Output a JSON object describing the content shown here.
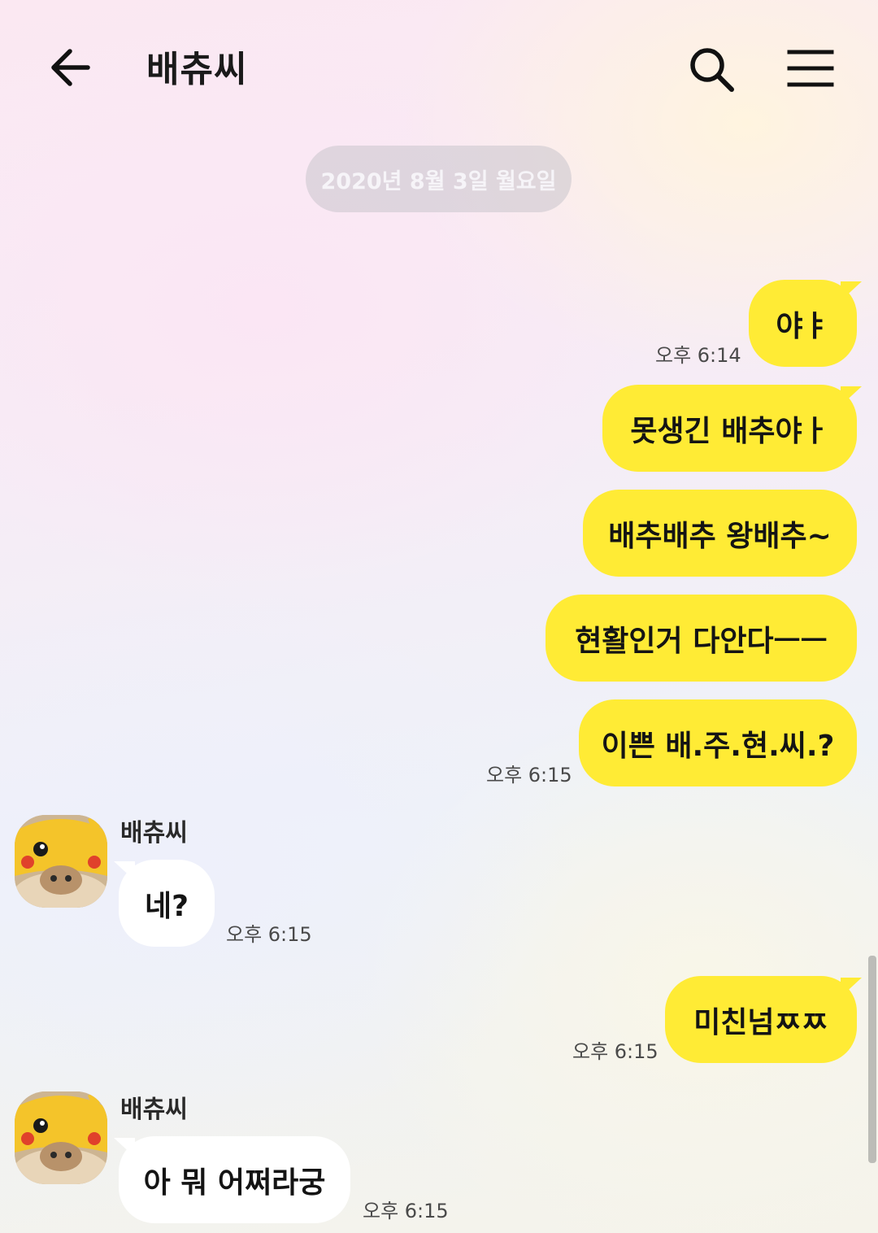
{
  "header": {
    "title": "배츄씨",
    "back_icon": "back-arrow-icon",
    "search_icon": "search-icon",
    "menu_icon": "menu-icon"
  },
  "date_divider": "2020년 8월 3일 월요일",
  "messages": [
    {
      "from": "me",
      "text": "야ㅑ",
      "time": "오후 6:14"
    },
    {
      "from": "me",
      "text": "못생긴 배추야ㅏ",
      "time": ""
    },
    {
      "from": "me",
      "text": "배추배추 왕배추~",
      "time": ""
    },
    {
      "from": "me",
      "text": "현활인거 다안다ㅡㅡ",
      "time": ""
    },
    {
      "from": "me",
      "text": "이쁜 배.주.현.씨.?",
      "time": "오후 6:15"
    },
    {
      "from": "other",
      "sender": "배츄씨",
      "text": "네?",
      "time": "오후 6:15"
    },
    {
      "from": "me",
      "text": "미친넘ㅉㅉ",
      "time": "오후 6:15"
    },
    {
      "from": "other",
      "sender": "배츄씨",
      "text": "아 뭐 어쩌라궁",
      "time": "오후 6:15"
    }
  ],
  "colors": {
    "sent_bubble": "#ffeb35",
    "received_bubble": "#ffffff"
  }
}
